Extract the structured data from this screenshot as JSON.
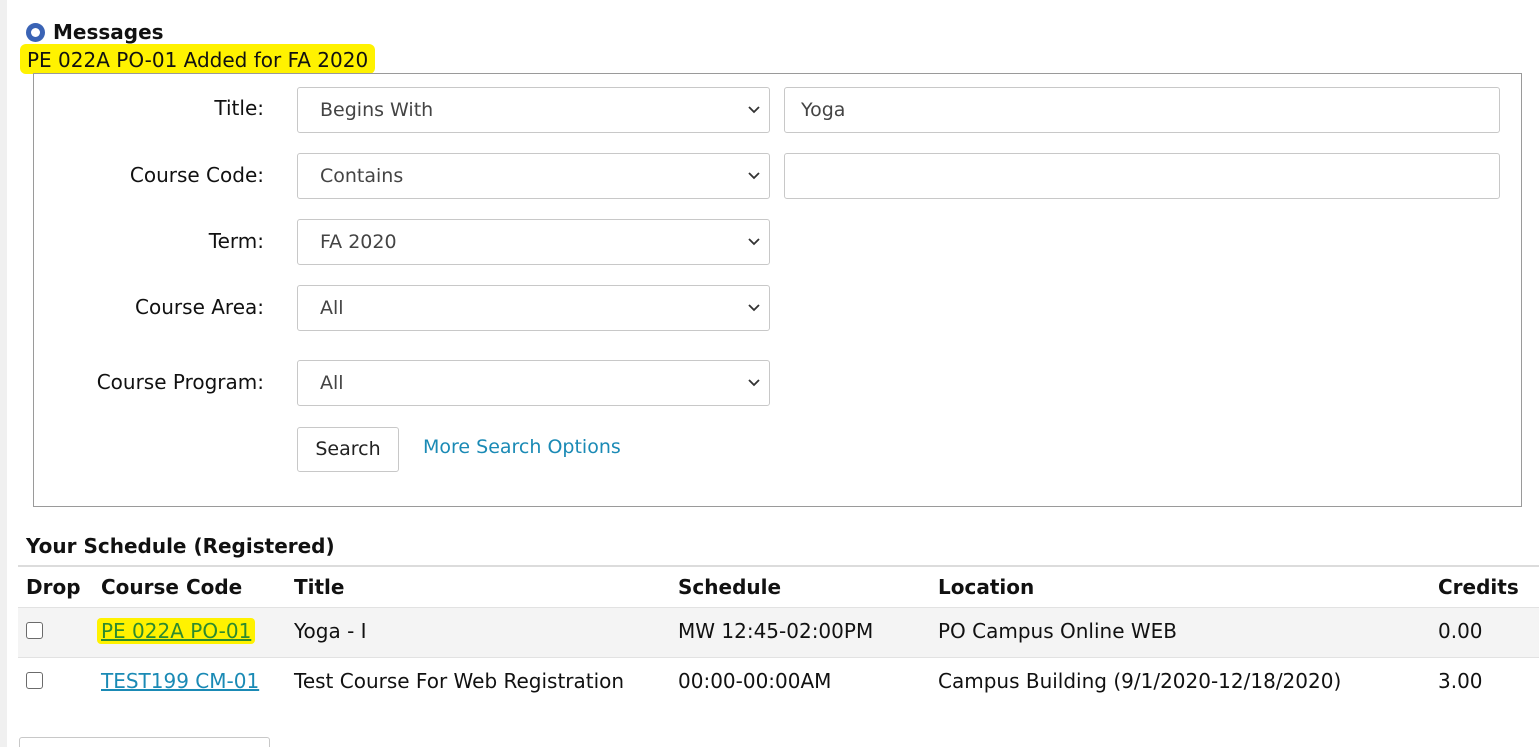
{
  "messages": {
    "title": "Messages",
    "text": "PE 022A PO-01 Added for FA 2020",
    "highlight_color": "#fff200",
    "icon": "info-circle-icon"
  },
  "search": {
    "title_label": "Title:",
    "title_operator": "Begins With",
    "title_value": "Yoga",
    "course_code_label": "Course Code:",
    "course_code_operator": "Contains",
    "course_code_value": "",
    "term_label": "Term:",
    "term_value": "FA 2020",
    "course_area_label": "Course Area:",
    "course_area_value": "All",
    "course_program_label": "Course Program:",
    "course_program_value": "All",
    "search_button": "Search",
    "more_options_link": "More Search Options",
    "link_color": "#1a8ab5"
  },
  "schedule": {
    "title": "Your Schedule (Registered)",
    "columns": [
      "Drop",
      "Course Code",
      "Title",
      "Schedule",
      "Location",
      "Credits"
    ],
    "rows": [
      {
        "drop_checked": false,
        "course_code": "PE 022A PO-01",
        "title": "Yoga - I",
        "schedule": "MW 12:45-02:00PM",
        "location": "PO Campus Online WEB",
        "credits": "0.00",
        "highlighted": true
      },
      {
        "drop_checked": false,
        "course_code": "TEST199 CM-01",
        "title": "Test Course For Web Registration",
        "schedule": "00:00-00:00AM",
        "location": "Campus Building (9/1/2020-12/18/2020)",
        "credits": "3.00",
        "highlighted": false
      }
    ]
  }
}
